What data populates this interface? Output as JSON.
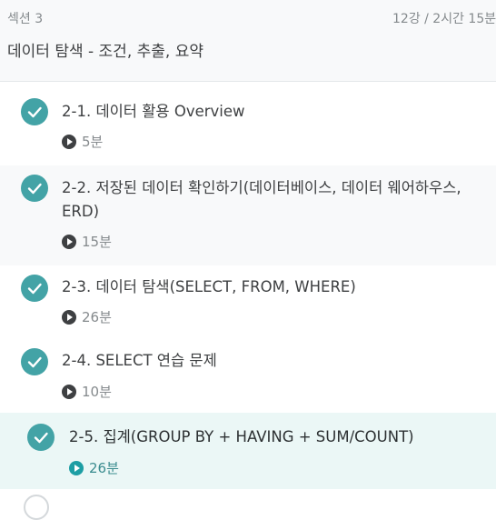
{
  "section": {
    "label": "섹션 3",
    "meta": "12강 / 2시간 15분",
    "title": "데이터 탐색 - 조건, 추출, 요약"
  },
  "lessons": [
    {
      "title": "2-1. 데이터 활용 Overview",
      "duration": "5분",
      "completed": true,
      "active": false
    },
    {
      "title": "2-2. 저장된 데이터 확인하기(데이터베이스, 데이터 웨어하우스, ERD)",
      "title_line1": "2-2. 저장된 데이터 확인하기(데이터베이스, 데이터 웨어하우스,",
      "title_line2": "ERD)",
      "duration": "15분",
      "completed": true,
      "active": false
    },
    {
      "title": "2-3. 데이터 탐색(SELECT, FROM, WHERE)",
      "duration": "26분",
      "completed": true,
      "active": false
    },
    {
      "title": "2-4. SELECT 연습 문제",
      "duration": "10분",
      "completed": true,
      "active": false
    },
    {
      "title": "2-5. 집계(GROUP BY + HAVING + SUM/COUNT)",
      "duration": "26분",
      "completed": true,
      "active": true
    }
  ],
  "colors": {
    "check": "#43a3a6",
    "active_bg": "#ebf7f6",
    "alt_bg": "#f8f9fa"
  }
}
